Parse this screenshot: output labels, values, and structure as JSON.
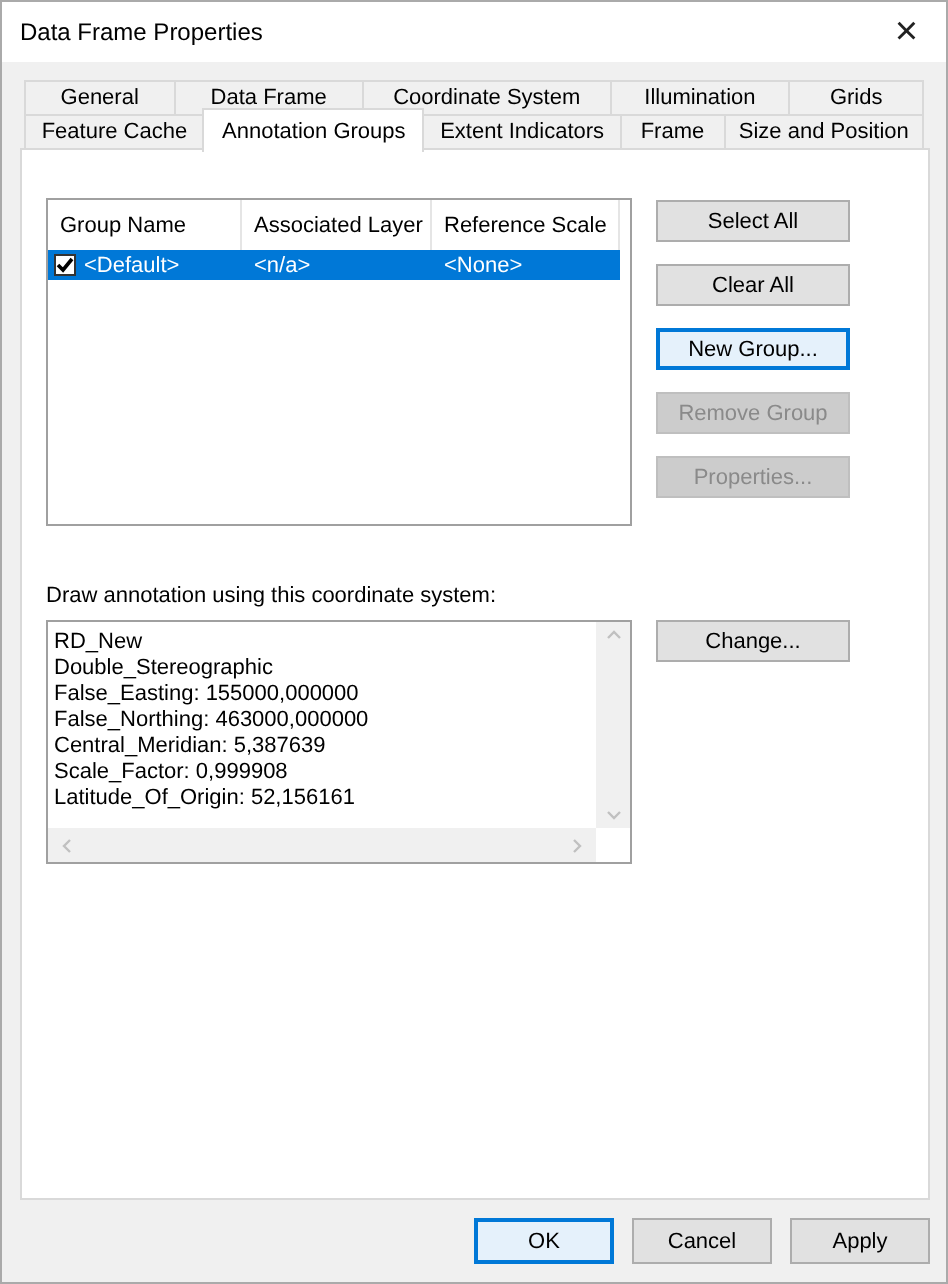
{
  "window": {
    "title": "Data Frame Properties",
    "close": "×"
  },
  "tab_rows": [
    [
      {
        "label": "General",
        "selected": false
      },
      {
        "label": "Data Frame",
        "selected": false
      },
      {
        "label": "Coordinate System",
        "selected": false
      },
      {
        "label": "Illumination",
        "selected": false
      },
      {
        "label": "Grids",
        "selected": false
      }
    ],
    [
      {
        "label": "Feature Cache",
        "selected": false
      },
      {
        "label": "Annotation Groups",
        "selected": true
      },
      {
        "label": "Extent Indicators",
        "selected": false
      },
      {
        "label": "Frame",
        "selected": false
      },
      {
        "label": "Size and Position",
        "selected": false
      }
    ]
  ],
  "groups_table": {
    "columns": [
      "Group Name",
      "Associated Layer",
      "Reference Scale"
    ],
    "rows": [
      {
        "cells": [
          "<Default>",
          "<n/a>",
          "<None>"
        ],
        "checked": true,
        "selected": true
      }
    ]
  },
  "group_buttons": [
    {
      "label": "Select All",
      "disabled": false,
      "focused": false
    },
    {
      "label": "Clear All",
      "disabled": false,
      "focused": false
    },
    {
      "label": "New Group...",
      "disabled": false,
      "focused": true
    },
    {
      "label": "Remove Group",
      "disabled": true,
      "focused": false
    },
    {
      "label": "Properties...",
      "disabled": true,
      "focused": false
    }
  ],
  "coordinate_system": {
    "label": "Draw annotation using this coordinate system:",
    "lines": [
      "RD_New",
      "Double_Stereographic",
      "False_Easting: 155000,000000",
      "False_Northing: 463000,000000",
      "Central_Meridian: 5,387639",
      "Scale_Factor: 0,999908",
      "Latitude_Of_Origin: 52,156161"
    ],
    "button": "Change..."
  },
  "footer_buttons": [
    {
      "label": "OK",
      "focused": true,
      "disabled": false
    },
    {
      "label": "Cancel",
      "focused": false,
      "disabled": false
    },
    {
      "label": "Apply",
      "focused": false,
      "disabled": false
    }
  ]
}
